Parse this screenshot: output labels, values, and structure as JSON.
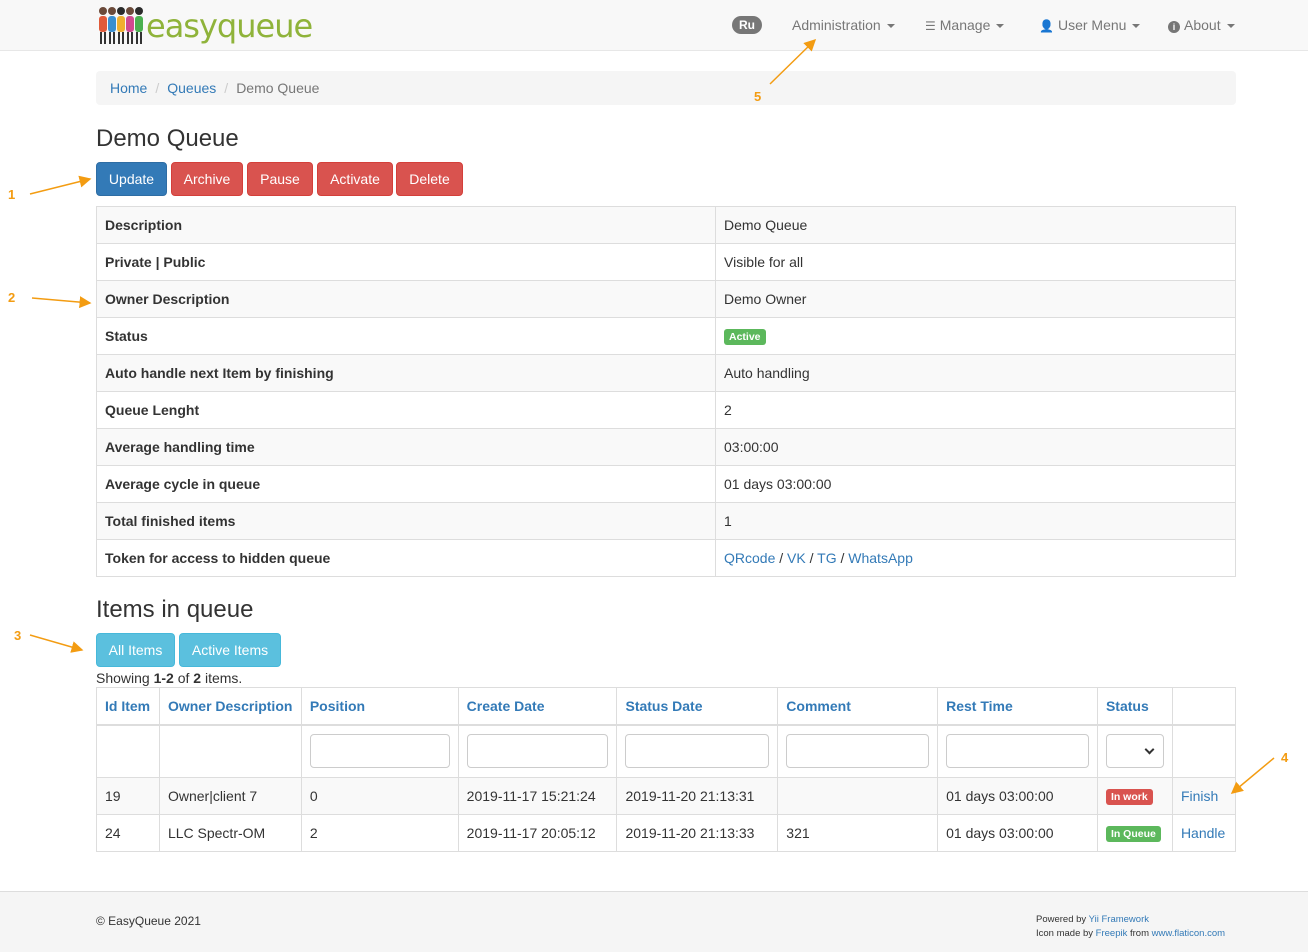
{
  "brand": {
    "name": "easyqueue"
  },
  "nav": {
    "lang_badge": "Ru",
    "items": [
      {
        "label": "Administration",
        "icon": ""
      },
      {
        "label": "Manage",
        "icon": "list-icon"
      },
      {
        "label": "User Menu",
        "icon": "user-icon"
      },
      {
        "label": "About",
        "icon": "info-icon"
      }
    ]
  },
  "breadcrumb": {
    "home": "Home",
    "queues": "Queues",
    "current": "Demo Queue",
    "separator": "/"
  },
  "page_title": "Demo Queue",
  "actions": {
    "update": "Update",
    "archive": "Archive",
    "pause": "Pause",
    "activate": "Activate",
    "delete": "Delete"
  },
  "details": {
    "description": {
      "label": "Description",
      "value": "Demo Queue"
    },
    "privacy": {
      "label": "Private | Public",
      "value": "Visible for all"
    },
    "owner": {
      "label": "Owner Description",
      "value": "Demo Owner"
    },
    "status": {
      "label": "Status",
      "value": "Active"
    },
    "auto_handle": {
      "label": "Auto handle next Item by finishing",
      "value": "Auto handling"
    },
    "queue_length": {
      "label": "Queue Lenght",
      "value": "2"
    },
    "avg_handling": {
      "label": "Average handling time",
      "value": "03:00:00"
    },
    "avg_cycle": {
      "label": "Average cycle in queue",
      "value": "01 days 03:00:00"
    },
    "total_finished": {
      "label": "Total finished items",
      "value": "1"
    },
    "token": {
      "label": "Token for access to hidden queue",
      "links": [
        "QRcode",
        "VK",
        "TG",
        "WhatsApp"
      ],
      "separator": " / "
    }
  },
  "items_section": {
    "title": "Items in queue",
    "all_items": "All Items",
    "active_items": "Active Items",
    "summary": {
      "prefix": "Showing ",
      "range": "1-2",
      "middle": " of ",
      "total": "2",
      "suffix": " items."
    }
  },
  "grid": {
    "columns": [
      "Id Item",
      "Owner Description",
      "Position",
      "Create Date",
      "Status Date",
      "Comment",
      "Rest Time",
      "Status"
    ],
    "rows": [
      {
        "id": "19",
        "owner": "Owner|client 7",
        "position": "0",
        "create_date": "2019-11-17 15:21:24",
        "status_date": "2019-11-20 21:13:31",
        "comment": "",
        "rest_time": "01 days 03:00:00",
        "status": "In work",
        "status_color": "#d9534f",
        "action": "Finish"
      },
      {
        "id": "24",
        "owner": "LLC Spectr-OM",
        "position": "2",
        "create_date": "2019-11-17 20:05:12",
        "status_date": "2019-11-20 21:13:33",
        "comment": "321",
        "rest_time": "01 days 03:00:00",
        "status": "In Queue",
        "status_color": "#5cb85c",
        "action": "Handle"
      }
    ]
  },
  "footer": {
    "copyright": "© EasyQueue 2021",
    "powered_prefix": "Powered by ",
    "powered_link": "Yii Framework",
    "icon_prefix": "Icon made by ",
    "icon_author": "Freepik",
    "icon_from": " from ",
    "icon_site": "www.flaticon.com"
  },
  "annotations": [
    "1",
    "2",
    "3",
    "4",
    "5"
  ],
  "colors": {
    "accent": "#337ab7",
    "danger": "#d9534f",
    "info": "#5bc0de",
    "success": "#5cb85c",
    "annotation": "#f39c12",
    "brand": "#8fb33a"
  }
}
